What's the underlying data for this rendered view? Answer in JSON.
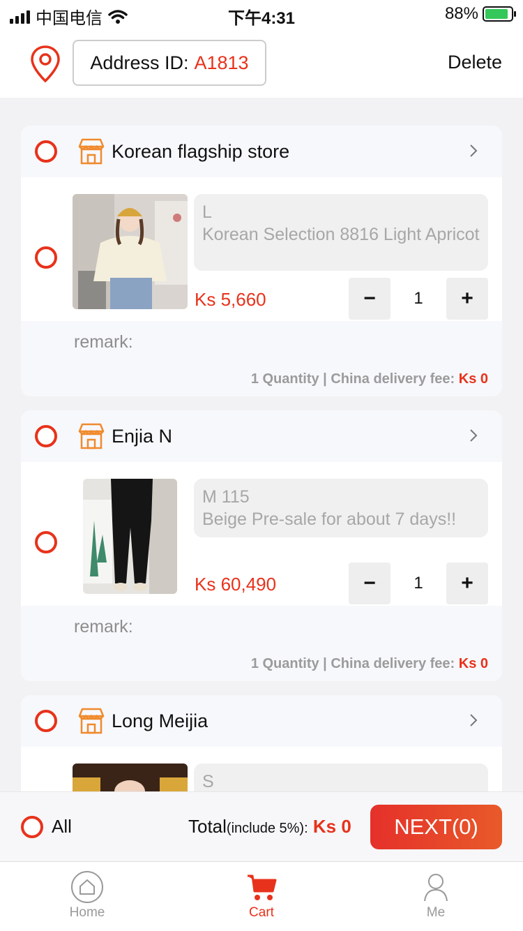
{
  "status_bar": {
    "carrier": "中国电信",
    "time": "下午4:31",
    "battery": "88%"
  },
  "header": {
    "address_label": "Address ID:",
    "address_id": "A1813",
    "delete_label": "Delete"
  },
  "stores": [
    {
      "name": "Korean flagship store",
      "item": {
        "size": "L",
        "description": "Korean Selection 8816 Light Apricot",
        "price": "Ks 5,660",
        "quantity": "1"
      },
      "remark_label": "remark:",
      "summary_quantity": "1 Quantity",
      "separator": "|",
      "delivery_label": "China delivery fee:",
      "delivery_fee": "Ks 0"
    },
    {
      "name": "Enjia N",
      "item": {
        "size": "M 115",
        "description": "Beige Pre-sale for about 7 days!!",
        "price": "Ks 60,490",
        "quantity": "1"
      },
      "remark_label": "remark:",
      "summary_quantity": "1 Quantity",
      "separator": "|",
      "delivery_label": "China delivery fee:",
      "delivery_fee": "Ks 0"
    },
    {
      "name": "Long Meijia",
      "item": {
        "size": "S"
      }
    }
  ],
  "stepper": {
    "minus": "−",
    "plus": "+"
  },
  "bottom_bar": {
    "select_all_label": "All",
    "total_label": "Total",
    "total_note": "(include 5%):",
    "total_value": "Ks 0",
    "next_label": "NEXT(0)"
  },
  "tabs": [
    {
      "label": "Home",
      "icon": "home-icon",
      "active": false
    },
    {
      "label": "Cart",
      "icon": "cart-icon",
      "active": true
    },
    {
      "label": "Me",
      "icon": "person-icon",
      "active": false
    }
  ],
  "colors": {
    "accent": "#e8321b",
    "store_icon": "#f08a2c",
    "success": "#34c759"
  }
}
